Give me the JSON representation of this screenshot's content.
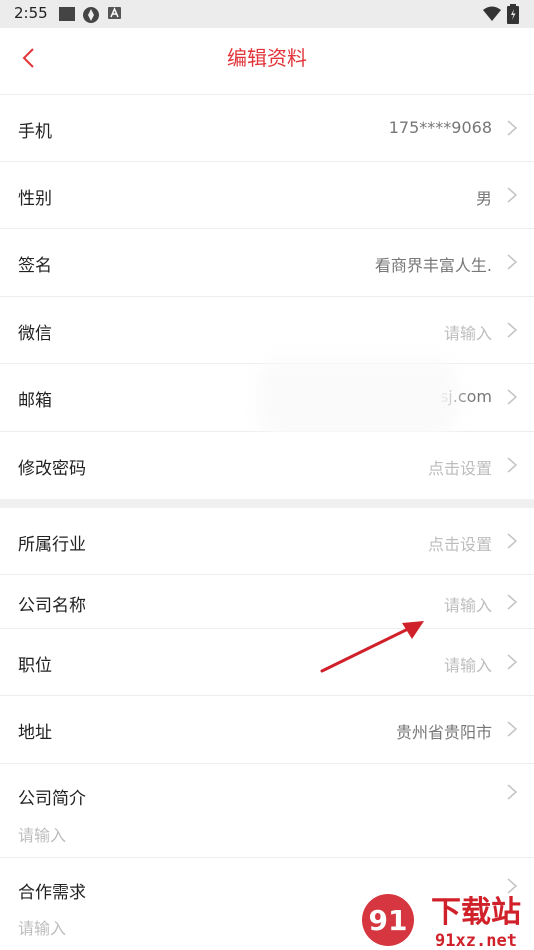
{
  "status_bar": {
    "time": "2:55"
  },
  "header": {
    "title": "编辑资料"
  },
  "rows": [
    {
      "label": "手机",
      "value": "175****9068"
    },
    {
      "label": "性别",
      "value": "男"
    },
    {
      "label": "签名",
      "value": "看商界丰富人生."
    },
    {
      "label": "微信",
      "value": "请输入"
    },
    {
      "label": "邮箱",
      "value": "sj.com"
    },
    {
      "label": "修改密码",
      "value": "点击设置"
    },
    {
      "label": "所属行业",
      "value": "点击设置"
    },
    {
      "label": "公司名称",
      "value": "请输入"
    },
    {
      "label": "职位",
      "value": "请输入"
    },
    {
      "label": "地址",
      "value": "贵州省贵阳市"
    },
    {
      "label": "公司简介",
      "value": "请输入"
    },
    {
      "label": "合作需求",
      "value": "请输入"
    }
  ],
  "watermark": {
    "logo_text": "91",
    "site_name": "下载站",
    "domain": "91xz.net"
  },
  "colors": {
    "accent": "#e2353b",
    "placeholder": "#bdbdbd",
    "value": "#777777",
    "divider": "#eeeeee",
    "annotation_arrow": "#d0202a"
  }
}
